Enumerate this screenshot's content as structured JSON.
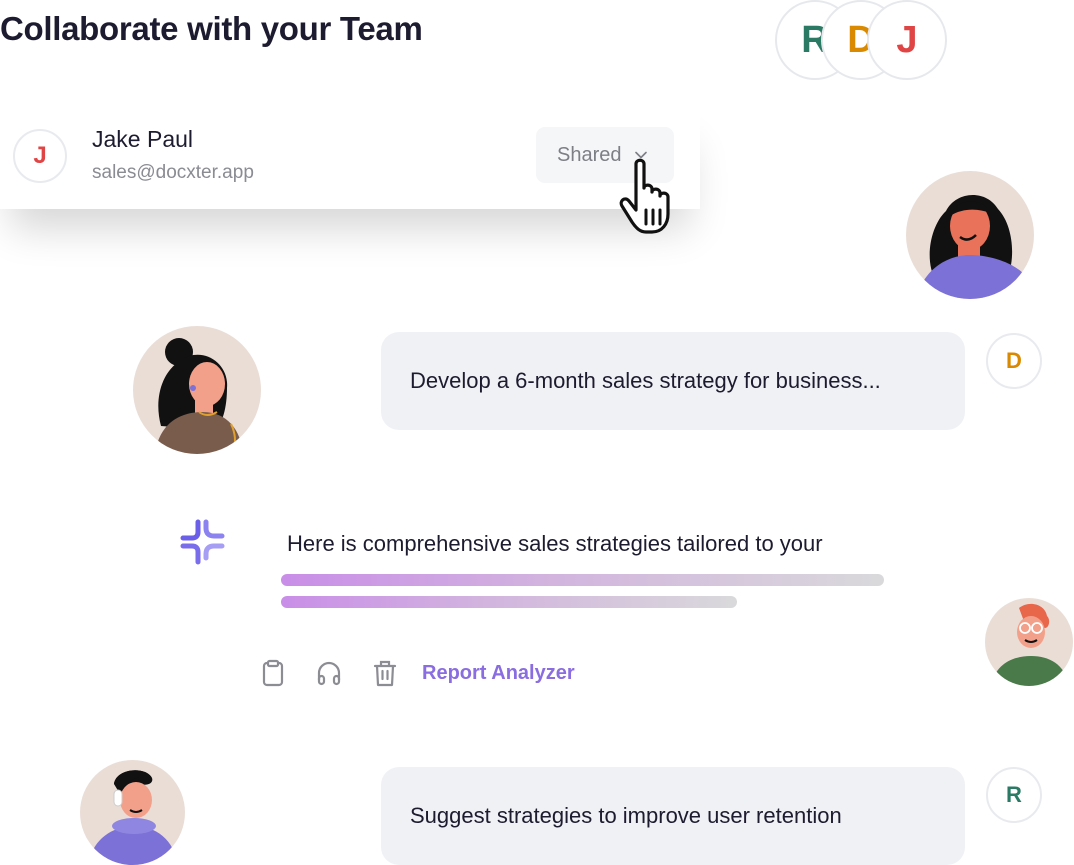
{
  "header": {
    "title": "Collaborate with your Team"
  },
  "collaborators": [
    {
      "initial": "R",
      "color": "#2a7a64"
    },
    {
      "initial": "D",
      "color": "#d98a00"
    },
    {
      "initial": "J",
      "color": "#e04545"
    }
  ],
  "user_card": {
    "initial": "J",
    "name": "Jake Paul",
    "email": "sales@docxter.app",
    "access_select": {
      "selected": "Shared",
      "icon": "chevron-down-icon"
    }
  },
  "chat": {
    "message_1": {
      "text": "Develop a 6-month sales strategy for business...",
      "sender_initial": "D"
    },
    "ai_response": {
      "icon": "ai-sparkle-icon",
      "text": "Here is comprehensive sales strategies tailored to your",
      "actions": [
        {
          "icon": "clipboard-icon",
          "label": "Copy"
        },
        {
          "icon": "headphones-icon",
          "label": "Listen"
        },
        {
          "icon": "trash-icon",
          "label": "Delete"
        }
      ],
      "link_label": "Report Analyzer"
    },
    "message_2": {
      "text": "Suggest strategies to improve user retention",
      "sender_initial": "R"
    }
  },
  "colors": {
    "accent": "#8a6de0",
    "bubble_bg": "#f0f1f5",
    "title": "#1d1b2f"
  }
}
